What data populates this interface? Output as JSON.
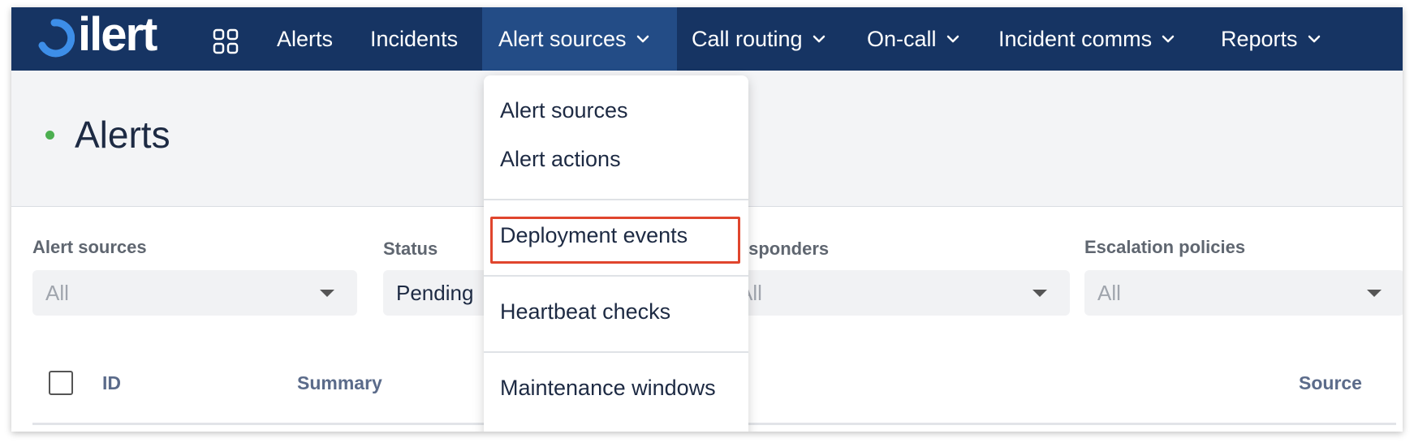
{
  "brand": {
    "name": "ilert"
  },
  "nav": {
    "items": [
      {
        "label": "Alerts"
      },
      {
        "label": "Incidents"
      },
      {
        "label": "Alert sources"
      },
      {
        "label": "Call routing"
      },
      {
        "label": "On-call"
      },
      {
        "label": "Incident comms"
      },
      {
        "label": "Reports"
      }
    ],
    "active": "Alert sources"
  },
  "page": {
    "title": "Alerts"
  },
  "filters": [
    {
      "label": "Alert sources",
      "value": "All"
    },
    {
      "label": "Status",
      "value": "Pending"
    },
    {
      "label": "Responders",
      "value": "All"
    },
    {
      "label": "Escalation policies",
      "value": "All"
    }
  ],
  "table": {
    "headers": [
      "ID",
      "Summary",
      "Source"
    ]
  },
  "dropdown": {
    "items": [
      {
        "label": "Alert sources"
      },
      {
        "label": "Alert actions"
      },
      {
        "label": "Deployment events"
      },
      {
        "label": "Heartbeat checks"
      },
      {
        "label": "Maintenance windows"
      }
    ],
    "highlighted": "Deployment events"
  },
  "colors": {
    "nav_bg": "#163463",
    "nav_active": "#234c86",
    "accent_highlight": "#e0452d",
    "status_dot": "#4caf50"
  }
}
